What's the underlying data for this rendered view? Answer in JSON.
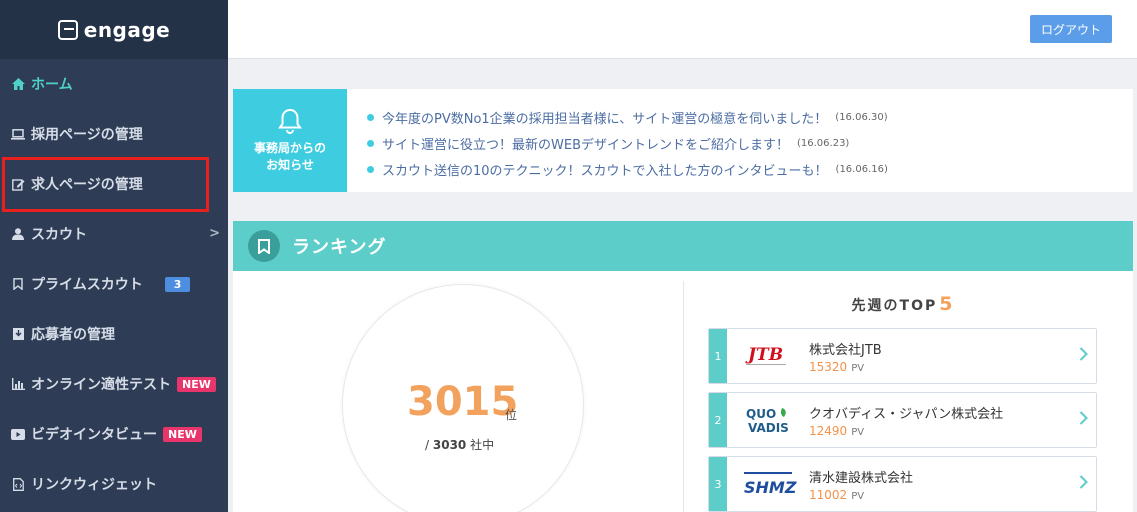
{
  "brand": {
    "name": "engage"
  },
  "header": {
    "logout_label": "ログアウト"
  },
  "sidebar": {
    "items": [
      {
        "label": "ホーム",
        "icon": "home-icon",
        "active": true
      },
      {
        "label": "採用ページの管理",
        "icon": "laptop-icon"
      },
      {
        "label": "求人ページの管理",
        "icon": "edit-icon"
      },
      {
        "label": "スカウト",
        "icon": "user-icon",
        "chevron": ">"
      },
      {
        "label": "プライムスカウト",
        "icon": "bookmark-icon",
        "badge": "3"
      },
      {
        "label": "応募者の管理",
        "icon": "inbox-icon"
      },
      {
        "label": "オンライン適性テスト",
        "icon": "bar-chart-icon",
        "badge_new": "NEW"
      },
      {
        "label": "ビデオインタビュー",
        "icon": "video-icon",
        "badge_new": "NEW"
      },
      {
        "label": "リンクウィジェット",
        "icon": "code-file-icon"
      }
    ]
  },
  "notice": {
    "title_line1": "事務局からの",
    "title_line2": "お知らせ",
    "items": [
      {
        "text": "今年度のPV数No1企業の採用担当者様に、サイト運営の極意を伺いました！",
        "date": "(16.06.30)"
      },
      {
        "text": "サイト運営に役立つ！最新のWEBデザイントレンドをご紹介します！",
        "date": "(16.06.23)"
      },
      {
        "text": "スカウト送信の10のテクニック！スカウトで入社した方のインタビューも！",
        "date": "(16.06.16)"
      }
    ]
  },
  "ranking": {
    "title": "ランキング",
    "rank": "3015",
    "rank_unit": "位",
    "total_prefix": "/",
    "total": "3030",
    "total_unit": "社中",
    "top_label": "先週のTOP",
    "top_count": "5",
    "entries": [
      {
        "rank": "1",
        "name": "株式会社JTB",
        "pv": "15320",
        "pv_unit": "PV",
        "logo": "JTB"
      },
      {
        "rank": "2",
        "name": "クオバディス・ジャパン株式会社",
        "pv": "12490",
        "pv_unit": "PV",
        "logo_line1": "QUO",
        "logo_line2": "VADIS"
      },
      {
        "rank": "3",
        "name": "清水建設株式会社",
        "pv": "11002",
        "pv_unit": "PV",
        "logo": "SHMZ"
      }
    ]
  },
  "colors": {
    "sidebar_bg": "#2e3d55",
    "accent_teal": "#5ccdc9",
    "notice_cyan": "#3ecde0",
    "orange": "#f2a25c",
    "logout_blue": "#5b9de8",
    "badge_pink": "#e8356b"
  }
}
